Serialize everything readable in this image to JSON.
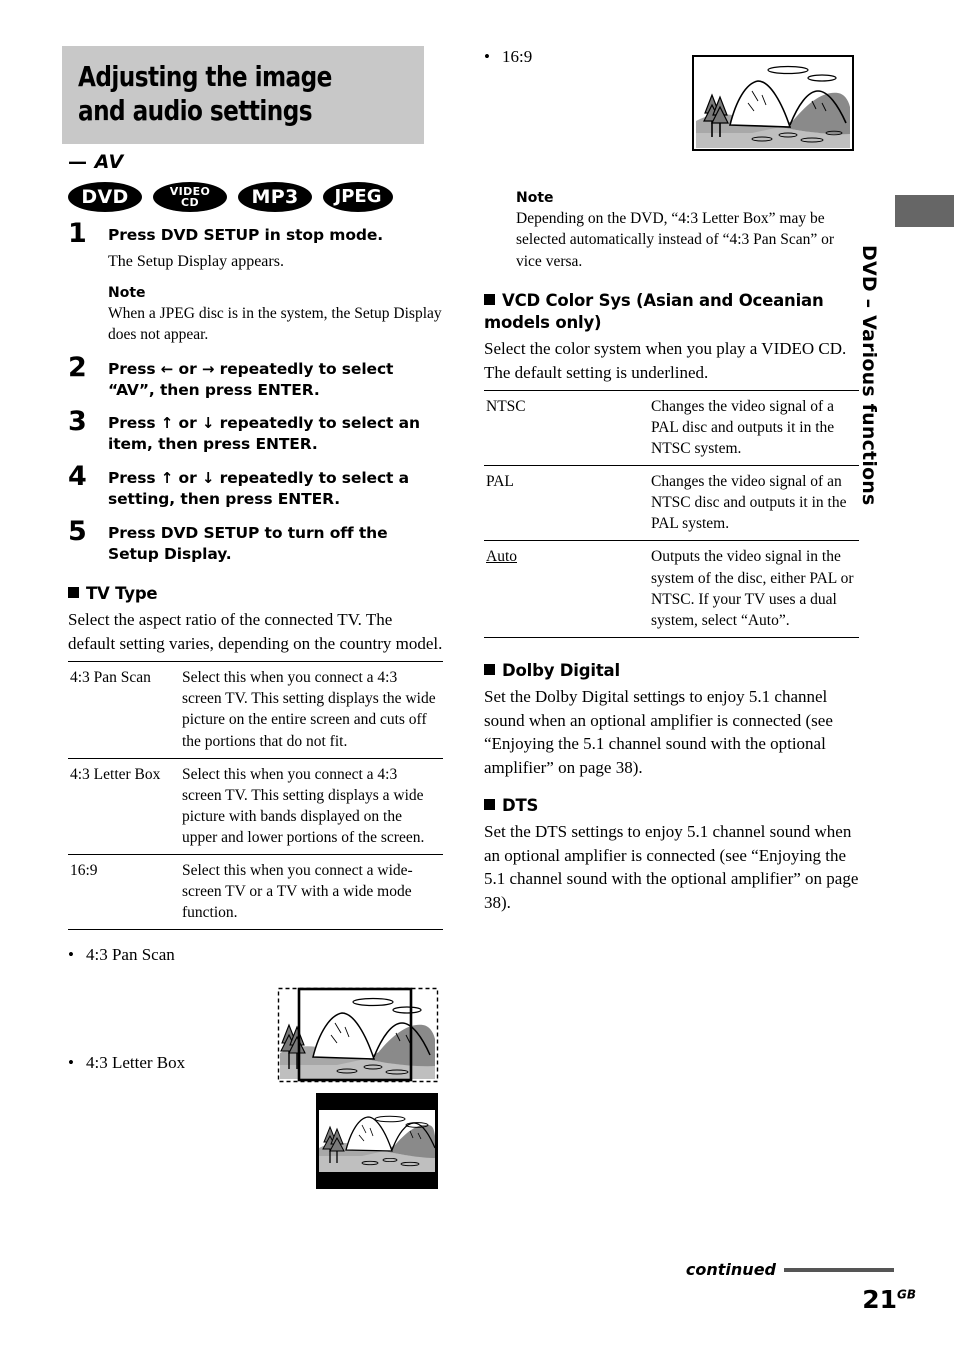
{
  "header": {
    "title": "Adjusting the image and audio settings",
    "subtitle_dash": "—",
    "subtitle": "AV"
  },
  "badges": [
    {
      "name": "dvd",
      "line1": "DVD",
      "line2": ""
    },
    {
      "name": "video-cd",
      "line1": "VIDEO",
      "line2": "CD"
    },
    {
      "name": "mp3",
      "line1": "MP3",
      "line2": ""
    },
    {
      "name": "jpeg",
      "line1": "JPEG",
      "line2": ""
    }
  ],
  "steps": [
    {
      "num": "1",
      "text": "Press DVD SETUP in stop mode.",
      "sub": "The Setup Display appears.",
      "note_head": "Note",
      "note_body": "When a JPEG disc is in the system, the Setup Display does not appear."
    },
    {
      "num": "2",
      "text_a": "Press ",
      "arrow1": "←",
      "text_b": " or ",
      "arrow2": "→",
      "text_c": " repeatedly to select “AV”, then press ENTER."
    },
    {
      "num": "3",
      "text_a": "Press ",
      "arrow1": "↑",
      "text_b": " or ",
      "arrow2": "↓",
      "text_c": " repeatedly to select an item, then press ENTER."
    },
    {
      "num": "4",
      "text_a": "Press ",
      "arrow1": "↑",
      "text_b": " or ",
      "arrow2": "↓",
      "text_c": " repeatedly to select a setting, then press ENTER."
    },
    {
      "num": "5",
      "text": "Press DVD SETUP to turn off the Setup Display."
    }
  ],
  "tv_type": {
    "heading": "TV Type",
    "body": "Select the aspect ratio of the connected TV. The default setting varies, depending on the country model.",
    "rows": [
      {
        "key": "4:3 Pan Scan",
        "value": "Select this when you connect a 4:3 screen TV. This setting displays the wide picture on the entire screen and cuts off the portions that do not fit."
      },
      {
        "key": "4:3 Letter Box",
        "value": "Select this when you connect a 4:3 screen TV. This setting displays a wide picture with bands displayed on the upper and lower portions of the screen."
      },
      {
        "key": "16:9",
        "value": "Select this when you connect a wide-screen TV or a TV with a wide mode function."
      }
    ]
  },
  "illustrations": [
    {
      "name": "pan-scan",
      "label": "4:3 Pan Scan"
    },
    {
      "name": "letter-box",
      "label": "4:3 Letter Box"
    },
    {
      "name": "sixteen-nine",
      "label": "16:9"
    }
  ],
  "right_note": {
    "head": "Note",
    "body": "Depending on the DVD, “4:3 Letter Box” may be selected automatically instead of “4:3 Pan Scan” or vice versa."
  },
  "vcd_color_sys": {
    "heading": "VCD Color Sys (Asian and Oceanian models only)",
    "body": "Select the color system when you play a VIDEO CD. The default setting is underlined.",
    "rows": [
      {
        "key": "NTSC",
        "underlined": false,
        "value": "Changes the video signal of a PAL disc and outputs it in the NTSC system."
      },
      {
        "key": "PAL",
        "underlined": false,
        "value": "Changes the video signal of an NTSC disc and outputs it in the PAL system."
      },
      {
        "key": "Auto",
        "underlined": true,
        "value": "Outputs the video signal in the system of the disc, either PAL or NTSC. If your TV uses a dual system, select “Auto”."
      }
    ]
  },
  "dolby_digital": {
    "heading": "Dolby Digital",
    "body": "Set the Dolby Digital settings to enjoy 5.1 channel sound when an optional amplifier is connected (see “Enjoying the 5.1 channel sound with the optional amplifier” on page 38)."
  },
  "dts": {
    "heading": "DTS",
    "body": "Set the DTS settings to enjoy 5.1 channel sound when an optional amplifier is connected (see “Enjoying the 5.1 channel sound with the optional amplifier” on page 38)."
  },
  "side_tab": {
    "label": "DVD – Various functions",
    "color": "#666666"
  },
  "footer": {
    "continued": "continued",
    "page_number": "21",
    "page_suffix": "GB"
  }
}
